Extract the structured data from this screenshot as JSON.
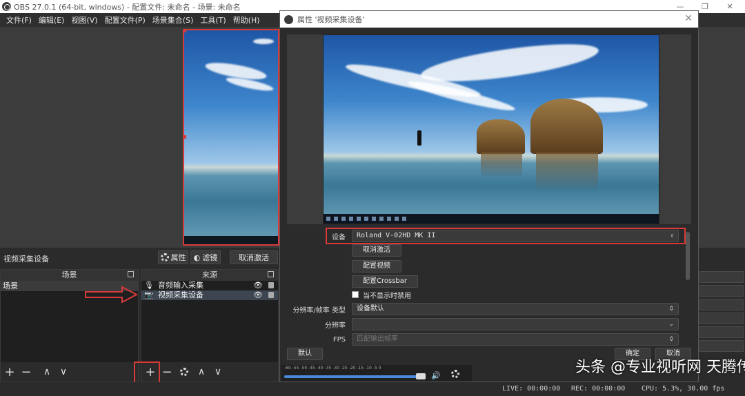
{
  "main_window": {
    "title": "OBS 27.0.1 (64-bit, windows) - 配置文件: 未命名 - 场景: 未命名",
    "window_controls": [
      "—",
      "❐",
      "✕"
    ]
  },
  "menu": [
    "文件(F)",
    "编辑(E)",
    "视图(V)",
    "配置文件(P)",
    "场景集合(S)",
    "工具(T)",
    "帮助(H)"
  ],
  "source_toolbar": {
    "selected_source": "视频采集设备",
    "properties_label": "属性",
    "filters_label": "滤镜",
    "deactivate_label": "取消激活"
  },
  "scenes_dock": {
    "title": "场景",
    "items": [
      "场景"
    ],
    "footer_icons": [
      "add-icon",
      "remove-icon",
      "move-up-icon",
      "move-down-icon"
    ]
  },
  "sources_dock": {
    "title": "来源",
    "items": [
      {
        "label": "音频输入采集",
        "icon": "microphone-icon",
        "visible": true,
        "locked": true,
        "selected": false
      },
      {
        "label": "视频采集设备",
        "icon": "camera-icon",
        "visible": true,
        "locked": true,
        "selected": true
      }
    ],
    "footer_icons": [
      "add-icon",
      "remove-icon",
      "gear-icon",
      "move-up-icon",
      "move-down-icon"
    ]
  },
  "properties_dialog": {
    "title": "属性 '视频采集设备'",
    "device_label": "设备",
    "device_value": "Roland V-02HD MK II",
    "deactivate_button": "取消激活",
    "configure_video_button": "配置视频",
    "configure_crossbar_button": "配置Crossbar",
    "disable_when_hidden_label": "当不显示时禁用",
    "disable_when_hidden_checked": false,
    "resolution_fps_type_label": "分辨率/帧率 类型",
    "resolution_fps_type_value": "设备默认",
    "resolution_label": "分辨率",
    "resolution_value": "",
    "fps_label": "FPS",
    "fps_value": "匹配输出帧率",
    "defaults_button": "默认",
    "ok_button": "确定",
    "cancel_button": "取消",
    "meter_ticks": "-60 -55 -50 -45 -40 -35 -30 -25 -20 -15 -10 -5 0"
  },
  "status_bar": {
    "live": "LIVE: 00:00:00",
    "rec": "REC: 00:00:00",
    "cpu": "CPU: 5.3%, 30.00 fps"
  },
  "watermark": "头条 @专业视听网 天腾传媒",
  "colors": {
    "highlight_red": "#d83a3a",
    "panel_dark": "#2b2b2b",
    "selection": "#3d4550"
  }
}
